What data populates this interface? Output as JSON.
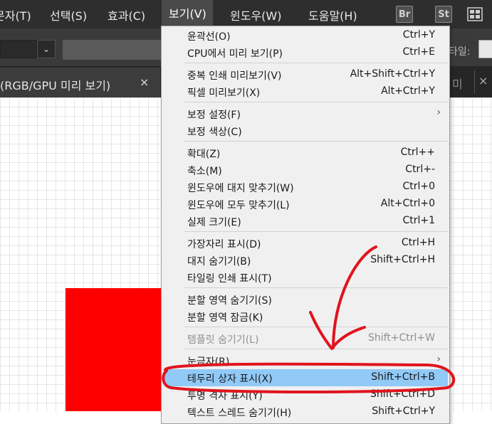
{
  "menubar": {
    "items": [
      "문자(T)",
      "선택(S)",
      "효과(C)",
      "보기(V)",
      "윈도우(W)",
      "도움말(H)"
    ],
    "bridge_label": "Br",
    "stock_label": "St"
  },
  "controlbar": {
    "label": "타일:"
  },
  "tabs": [
    {
      "title": "(RGB/GPU 미리 보기)",
      "close": "×"
    },
    {
      "title": "미",
      "close": "×"
    }
  ],
  "view_menu": {
    "items": [
      {
        "label": "윤곽선(O)",
        "shortcut": "Ctrl+Y"
      },
      {
        "label": "CPU에서 미리 보기(P)",
        "shortcut": "Ctrl+E"
      },
      {
        "label": "중복 인쇄 미리보기(V)",
        "shortcut": "Alt+Shift+Ctrl+Y"
      },
      {
        "label": "픽셀 미리보기(X)",
        "shortcut": "Alt+Ctrl+Y"
      },
      {
        "label": "보정 설정(F)",
        "shortcut": "",
        "submenu": "›"
      },
      {
        "label": "보정 색상(C)",
        "shortcut": ""
      },
      {
        "label": "확대(Z)",
        "shortcut": "Ctrl++"
      },
      {
        "label": "축소(M)",
        "shortcut": "Ctrl+-"
      },
      {
        "label": "윈도우에 대지 맞추기(W)",
        "shortcut": "Ctrl+0"
      },
      {
        "label": "윈도우에 모두 맞추기(L)",
        "shortcut": "Alt+Ctrl+0"
      },
      {
        "label": "실제 크기(E)",
        "shortcut": "Ctrl+1"
      },
      {
        "label": "가장자리 표시(D)",
        "shortcut": "Ctrl+H"
      },
      {
        "label": "대지 숨기기(B)",
        "shortcut": "Shift+Ctrl+H"
      },
      {
        "label": "타일링 인쇄 표시(T)",
        "shortcut": ""
      },
      {
        "label": "분할 영역 숨기기(S)",
        "shortcut": ""
      },
      {
        "label": "분할 영역 잠금(K)",
        "shortcut": ""
      },
      {
        "label": "템플릿 숨기기(L)",
        "shortcut": "Shift+Ctrl+W",
        "disabled": true
      },
      {
        "label": "눈금자(R)",
        "shortcut": "",
        "submenu": "›"
      },
      {
        "label": "테두리 상자 표시(X)",
        "shortcut": "Shift+Ctrl+B",
        "highlighted": true
      },
      {
        "label": "투명 격자 표시(Y)",
        "shortcut": "Shift+Ctrl+D"
      },
      {
        "label": "텍스트 스레드 숨기기(H)",
        "shortcut": "Shift+Ctrl+Y"
      }
    ]
  },
  "colors": {
    "menubar_bg": "#2e2e2e",
    "menu_bg": "#f0f0f0",
    "highlight": "#91c9f7",
    "annotation": "#e0141e",
    "artwork_fill": "#ff0000"
  }
}
